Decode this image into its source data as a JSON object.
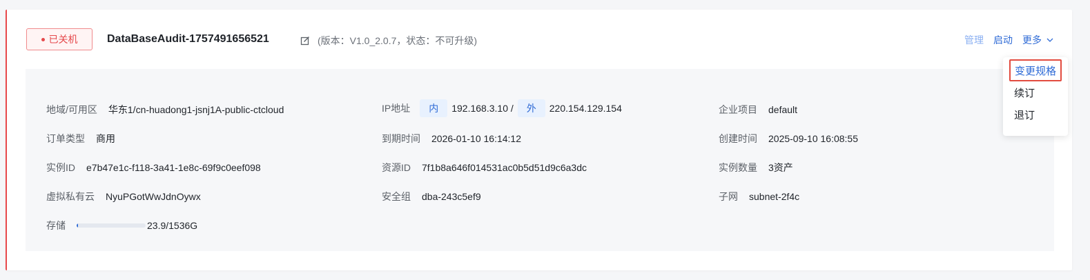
{
  "header": {
    "status": "已关机",
    "title": "DataBaseAudit-1757491656521",
    "version_info": "(版本：V1.0_2.0.7，状态：不可升级)",
    "actions": {
      "manage": "管理",
      "start": "启动",
      "more": "更多"
    }
  },
  "dropdown": {
    "items": [
      "变更规格",
      "续订",
      "退订"
    ]
  },
  "details": {
    "region": {
      "label": "地域/可用区",
      "value": "华东1/cn-huadong1-jsnj1A-public-ctcloud"
    },
    "ip": {
      "label": "IP地址",
      "inner_tag": "内",
      "inner_value": "192.168.3.10 /",
      "outer_tag": "外",
      "outer_value": "220.154.129.154"
    },
    "project": {
      "label": "企业项目",
      "value": "default"
    },
    "order_type": {
      "label": "订单类型",
      "value": "商用"
    },
    "expire_time": {
      "label": "到期时间",
      "value": "2026-01-10 16:14:12"
    },
    "create_time": {
      "label": "创建时间",
      "value": "2025-09-10 16:08:55"
    },
    "instance_id": {
      "label": "实例ID",
      "value": "e7b47e1c-f118-3a41-1e8c-69f9c0eef098"
    },
    "resource_id": {
      "label": "资源ID",
      "value": "7f1b8a646f014531ac0b5d51d9c6a3dc"
    },
    "instance_count": {
      "label": "实例数量",
      "value": "3资产"
    },
    "vpc": {
      "label": "虚拟私有云",
      "value": "NyuPGotWwJdnOywx"
    },
    "security_group": {
      "label": "安全组",
      "value": "dba-243c5ef9"
    },
    "subnet": {
      "label": "子网",
      "value": "subnet-2f4c"
    },
    "storage": {
      "label": "存储",
      "value": "23.9/1536G",
      "used_fraction": 0.0156
    }
  },
  "colors": {
    "accent": "#2f6bd6",
    "danger": "#e5484b",
    "highlight_border": "#e24b3f"
  }
}
